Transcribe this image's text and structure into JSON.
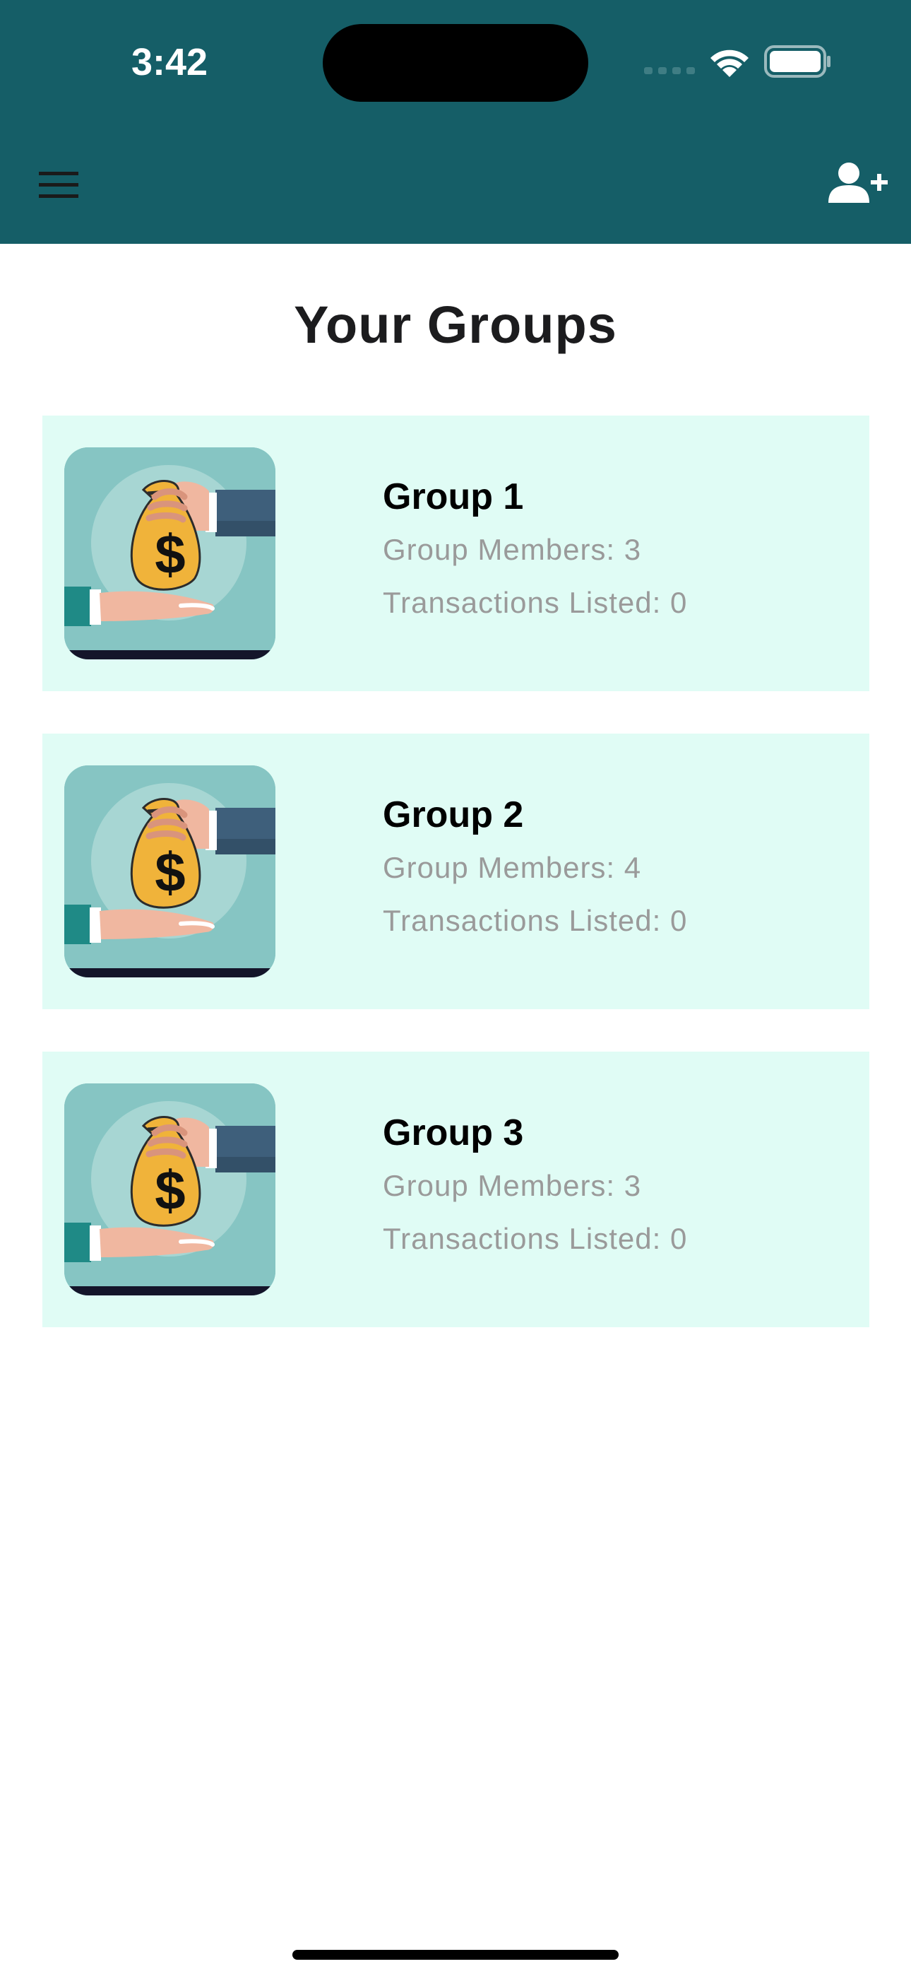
{
  "status_bar": {
    "time": "3:42"
  },
  "header": {
    "background_color": "#155e67",
    "menu_icon": "hamburger-menu-icon",
    "add_user_icon": "add-user-icon"
  },
  "page": {
    "title": "Your Groups"
  },
  "groups": [
    {
      "name": "Group 1",
      "members": "Group Members: 3",
      "transactions": "Transactions Listed: 0",
      "thumbnail_icon": "money-bag-handoff-image"
    },
    {
      "name": "Group 2",
      "members": "Group Members: 4",
      "transactions": "Transactions Listed: 0",
      "thumbnail_icon": "money-bag-handoff-image"
    },
    {
      "name": "Group 3",
      "members": "Group Members: 3",
      "transactions": "Transactions Listed: 0",
      "thumbnail_icon": "money-bag-handoff-image"
    }
  ],
  "colors": {
    "card_background": "#e0fcf5",
    "secondary_text": "#9a9a9a"
  }
}
